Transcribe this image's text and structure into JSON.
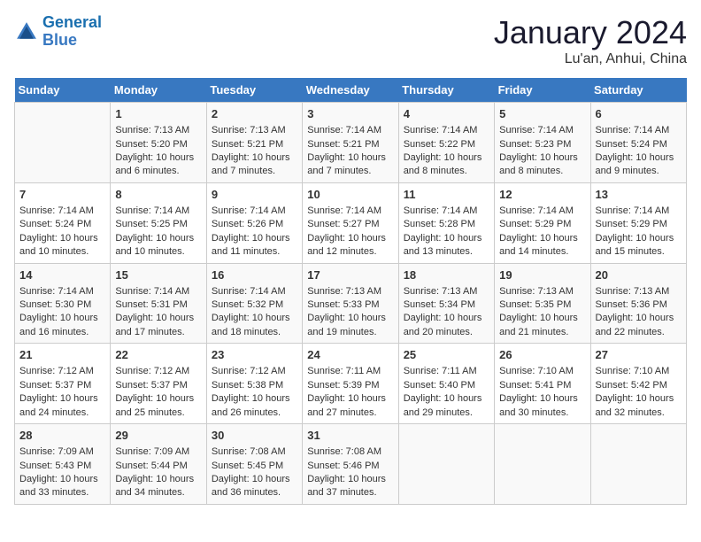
{
  "header": {
    "logo_line1": "General",
    "logo_line2": "Blue",
    "month_title": "January 2024",
    "location": "Lu'an, Anhui, China"
  },
  "days_of_week": [
    "Sunday",
    "Monday",
    "Tuesday",
    "Wednesday",
    "Thursday",
    "Friday",
    "Saturday"
  ],
  "weeks": [
    [
      {
        "day": "",
        "sunrise": "",
        "sunset": "",
        "daylight": ""
      },
      {
        "day": "1",
        "sunrise": "Sunrise: 7:13 AM",
        "sunset": "Sunset: 5:20 PM",
        "daylight": "Daylight: 10 hours and 6 minutes."
      },
      {
        "day": "2",
        "sunrise": "Sunrise: 7:13 AM",
        "sunset": "Sunset: 5:21 PM",
        "daylight": "Daylight: 10 hours and 7 minutes."
      },
      {
        "day": "3",
        "sunrise": "Sunrise: 7:14 AM",
        "sunset": "Sunset: 5:21 PM",
        "daylight": "Daylight: 10 hours and 7 minutes."
      },
      {
        "day": "4",
        "sunrise": "Sunrise: 7:14 AM",
        "sunset": "Sunset: 5:22 PM",
        "daylight": "Daylight: 10 hours and 8 minutes."
      },
      {
        "day": "5",
        "sunrise": "Sunrise: 7:14 AM",
        "sunset": "Sunset: 5:23 PM",
        "daylight": "Daylight: 10 hours and 8 minutes."
      },
      {
        "day": "6",
        "sunrise": "Sunrise: 7:14 AM",
        "sunset": "Sunset: 5:24 PM",
        "daylight": "Daylight: 10 hours and 9 minutes."
      }
    ],
    [
      {
        "day": "7",
        "sunrise": "Sunrise: 7:14 AM",
        "sunset": "Sunset: 5:24 PM",
        "daylight": "Daylight: 10 hours and 10 minutes."
      },
      {
        "day": "8",
        "sunrise": "Sunrise: 7:14 AM",
        "sunset": "Sunset: 5:25 PM",
        "daylight": "Daylight: 10 hours and 10 minutes."
      },
      {
        "day": "9",
        "sunrise": "Sunrise: 7:14 AM",
        "sunset": "Sunset: 5:26 PM",
        "daylight": "Daylight: 10 hours and 11 minutes."
      },
      {
        "day": "10",
        "sunrise": "Sunrise: 7:14 AM",
        "sunset": "Sunset: 5:27 PM",
        "daylight": "Daylight: 10 hours and 12 minutes."
      },
      {
        "day": "11",
        "sunrise": "Sunrise: 7:14 AM",
        "sunset": "Sunset: 5:28 PM",
        "daylight": "Daylight: 10 hours and 13 minutes."
      },
      {
        "day": "12",
        "sunrise": "Sunrise: 7:14 AM",
        "sunset": "Sunset: 5:29 PM",
        "daylight": "Daylight: 10 hours and 14 minutes."
      },
      {
        "day": "13",
        "sunrise": "Sunrise: 7:14 AM",
        "sunset": "Sunset: 5:29 PM",
        "daylight": "Daylight: 10 hours and 15 minutes."
      }
    ],
    [
      {
        "day": "14",
        "sunrise": "Sunrise: 7:14 AM",
        "sunset": "Sunset: 5:30 PM",
        "daylight": "Daylight: 10 hours and 16 minutes."
      },
      {
        "day": "15",
        "sunrise": "Sunrise: 7:14 AM",
        "sunset": "Sunset: 5:31 PM",
        "daylight": "Daylight: 10 hours and 17 minutes."
      },
      {
        "day": "16",
        "sunrise": "Sunrise: 7:14 AM",
        "sunset": "Sunset: 5:32 PM",
        "daylight": "Daylight: 10 hours and 18 minutes."
      },
      {
        "day": "17",
        "sunrise": "Sunrise: 7:13 AM",
        "sunset": "Sunset: 5:33 PM",
        "daylight": "Daylight: 10 hours and 19 minutes."
      },
      {
        "day": "18",
        "sunrise": "Sunrise: 7:13 AM",
        "sunset": "Sunset: 5:34 PM",
        "daylight": "Daylight: 10 hours and 20 minutes."
      },
      {
        "day": "19",
        "sunrise": "Sunrise: 7:13 AM",
        "sunset": "Sunset: 5:35 PM",
        "daylight": "Daylight: 10 hours and 21 minutes."
      },
      {
        "day": "20",
        "sunrise": "Sunrise: 7:13 AM",
        "sunset": "Sunset: 5:36 PM",
        "daylight": "Daylight: 10 hours and 22 minutes."
      }
    ],
    [
      {
        "day": "21",
        "sunrise": "Sunrise: 7:12 AM",
        "sunset": "Sunset: 5:37 PM",
        "daylight": "Daylight: 10 hours and 24 minutes."
      },
      {
        "day": "22",
        "sunrise": "Sunrise: 7:12 AM",
        "sunset": "Sunset: 5:37 PM",
        "daylight": "Daylight: 10 hours and 25 minutes."
      },
      {
        "day": "23",
        "sunrise": "Sunrise: 7:12 AM",
        "sunset": "Sunset: 5:38 PM",
        "daylight": "Daylight: 10 hours and 26 minutes."
      },
      {
        "day": "24",
        "sunrise": "Sunrise: 7:11 AM",
        "sunset": "Sunset: 5:39 PM",
        "daylight": "Daylight: 10 hours and 27 minutes."
      },
      {
        "day": "25",
        "sunrise": "Sunrise: 7:11 AM",
        "sunset": "Sunset: 5:40 PM",
        "daylight": "Daylight: 10 hours and 29 minutes."
      },
      {
        "day": "26",
        "sunrise": "Sunrise: 7:10 AM",
        "sunset": "Sunset: 5:41 PM",
        "daylight": "Daylight: 10 hours and 30 minutes."
      },
      {
        "day": "27",
        "sunrise": "Sunrise: 7:10 AM",
        "sunset": "Sunset: 5:42 PM",
        "daylight": "Daylight: 10 hours and 32 minutes."
      }
    ],
    [
      {
        "day": "28",
        "sunrise": "Sunrise: 7:09 AM",
        "sunset": "Sunset: 5:43 PM",
        "daylight": "Daylight: 10 hours and 33 minutes."
      },
      {
        "day": "29",
        "sunrise": "Sunrise: 7:09 AM",
        "sunset": "Sunset: 5:44 PM",
        "daylight": "Daylight: 10 hours and 34 minutes."
      },
      {
        "day": "30",
        "sunrise": "Sunrise: 7:08 AM",
        "sunset": "Sunset: 5:45 PM",
        "daylight": "Daylight: 10 hours and 36 minutes."
      },
      {
        "day": "31",
        "sunrise": "Sunrise: 7:08 AM",
        "sunset": "Sunset: 5:46 PM",
        "daylight": "Daylight: 10 hours and 37 minutes."
      },
      {
        "day": "",
        "sunrise": "",
        "sunset": "",
        "daylight": ""
      },
      {
        "day": "",
        "sunrise": "",
        "sunset": "",
        "daylight": ""
      },
      {
        "day": "",
        "sunrise": "",
        "sunset": "",
        "daylight": ""
      }
    ]
  ]
}
